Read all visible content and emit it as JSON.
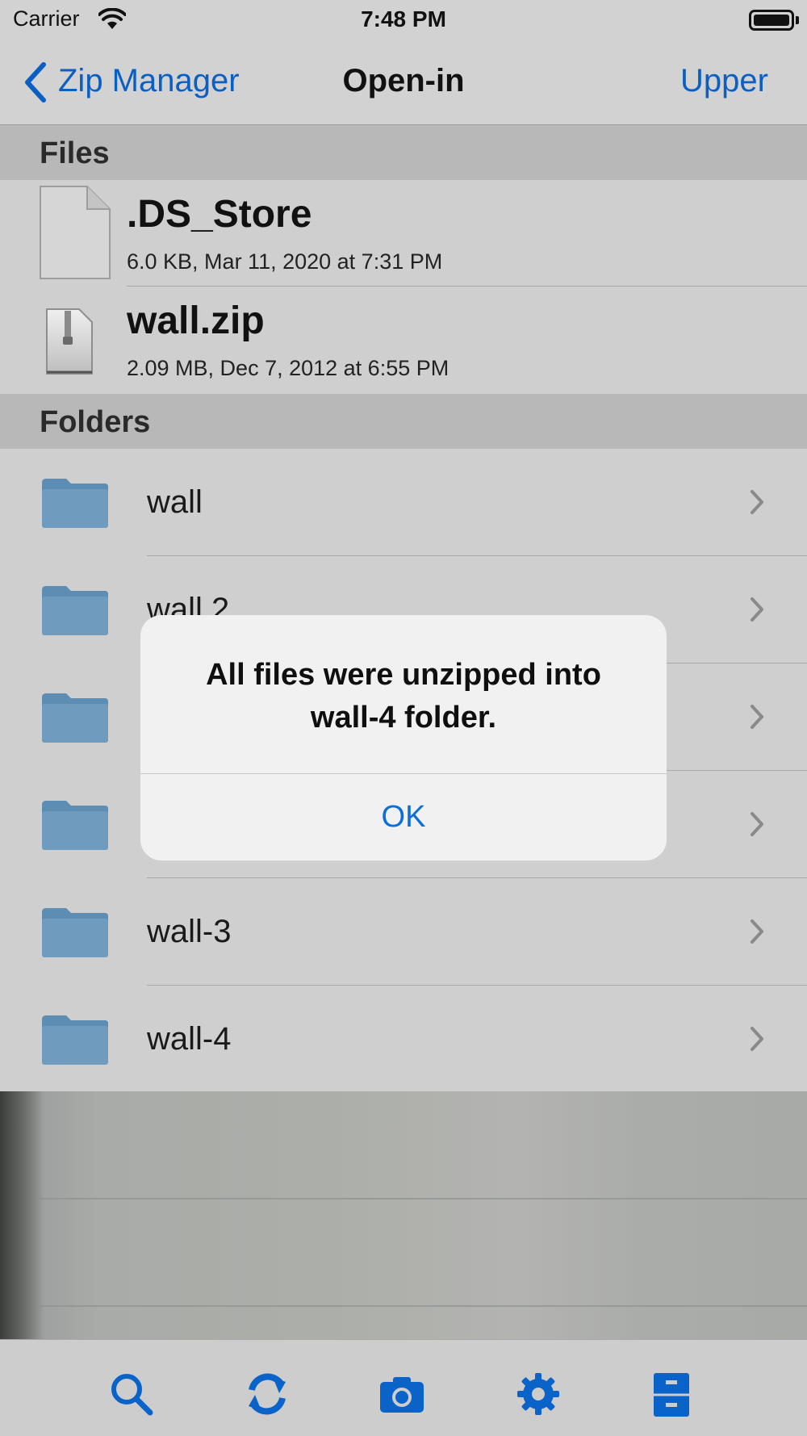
{
  "status_bar": {
    "carrier": "Carrier",
    "time": "7:48 PM"
  },
  "nav": {
    "back_label": "Zip Manager",
    "title": "Open-in",
    "right_button": "Upper"
  },
  "files_section": {
    "header": "Files",
    "items": [
      {
        "name": ".DS_Store",
        "meta": "6.0 KB, Mar 11, 2020 at 7:31 PM",
        "icon": "document-icon"
      },
      {
        "name": "wall.zip",
        "meta": "2.09 MB, Dec 7, 2012 at 6:55 PM",
        "icon": "zip-file-icon"
      }
    ]
  },
  "folders_section": {
    "header": "Folders",
    "items": [
      {
        "name": "wall"
      },
      {
        "name": "wall 2"
      },
      {
        "name": ""
      },
      {
        "name": ""
      },
      {
        "name": "wall-3"
      },
      {
        "name": "wall-4"
      }
    ]
  },
  "alert": {
    "message": "All files were unzipped into wall-4 folder.",
    "ok_label": "OK"
  },
  "toolbar": {
    "icons": [
      "search-icon",
      "refresh-icon",
      "camera-icon",
      "settings-gear-icon",
      "file-cabinet-icon"
    ]
  },
  "colors": {
    "accent": "#0a5fc4",
    "folder": "#6f9bbf"
  }
}
